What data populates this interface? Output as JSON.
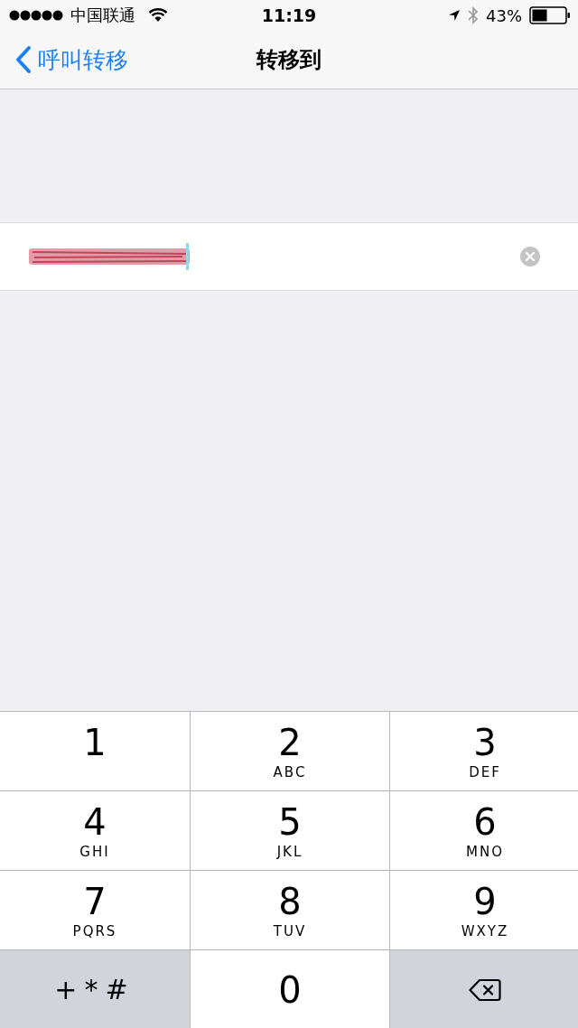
{
  "status_bar": {
    "carrier": "中国联通",
    "time": "11:19",
    "battery": "43%"
  },
  "nav": {
    "back": "呼叫转移",
    "title": "转移到"
  },
  "number_field": {
    "kind": "redacted"
  },
  "keypad": [
    {
      "kind": "digit",
      "digit": "1"
    },
    {
      "kind": "digit",
      "digit": "2",
      "letters": "ABC"
    },
    {
      "kind": "digit",
      "digit": "3",
      "letters": "DEF"
    },
    {
      "kind": "digit",
      "digit": "4",
      "letters": "GHI"
    },
    {
      "kind": "digit",
      "digit": "5",
      "letters": "JKL"
    },
    {
      "kind": "digit",
      "digit": "6",
      "letters": "MNO"
    },
    {
      "kind": "digit",
      "digit": "7",
      "letters": "PQRS"
    },
    {
      "kind": "digit",
      "digit": "8",
      "letters": "TUV"
    },
    {
      "kind": "digit",
      "digit": "9",
      "letters": "WXYZ"
    },
    {
      "kind": "symbols",
      "label": "+*#"
    },
    {
      "kind": "digit",
      "digit": "0"
    },
    {
      "kind": "delete"
    }
  ]
}
